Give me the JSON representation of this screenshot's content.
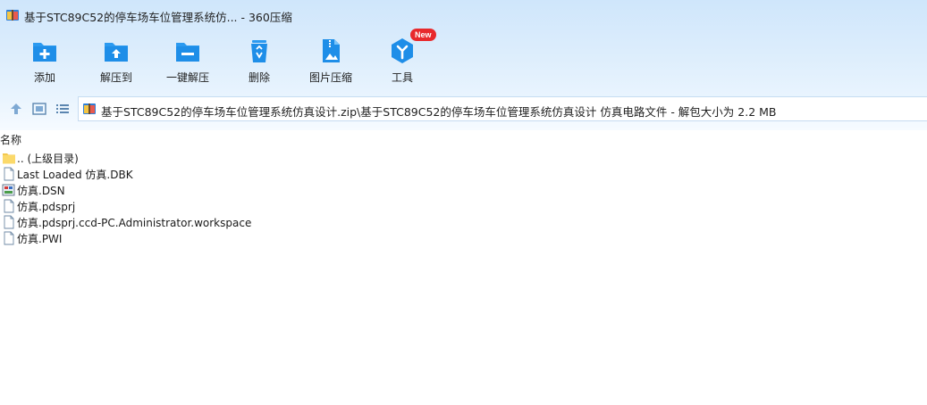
{
  "window": {
    "title": "基于STC89C52的停车场车位管理系统仿... - 360压缩"
  },
  "toolbar": {
    "items": [
      {
        "label": "添加",
        "icon": "add-folder-icon"
      },
      {
        "label": "解压到",
        "icon": "extract-to-icon"
      },
      {
        "label": "一键解压",
        "icon": "one-click-extract-icon"
      },
      {
        "label": "删除",
        "icon": "recycle-bin-icon"
      },
      {
        "label": "图片压缩",
        "icon": "image-compress-icon"
      },
      {
        "label": "工具",
        "icon": "tools-icon",
        "badge": "New"
      }
    ]
  },
  "nav": {
    "path": "基于STC89C52的停车场车位管理系统仿真设计.zip\\基于STC89C52的停车场车位管理系统仿真设计 仿真电路文件 - 解包大小为 2.2 MB"
  },
  "list": {
    "column_name": "名称",
    "files": [
      {
        "name": ".. (上级目录)",
        "icon": "folder-icon"
      },
      {
        "name": "Last Loaded 仿真.DBK",
        "icon": "file-icon"
      },
      {
        "name": "仿真.DSN",
        "icon": "dsn-file-icon"
      },
      {
        "name": "仿真.pdsprj",
        "icon": "file-icon"
      },
      {
        "name": "仿真.pdsprj.ccd-PC.Administrator.workspace",
        "icon": "file-icon"
      },
      {
        "name": "仿真.PWI",
        "icon": "file-icon"
      }
    ]
  },
  "colors": {
    "accent": "#1e8ee8",
    "accent_light": "#4fb2f5",
    "badge": "#e8292c"
  }
}
